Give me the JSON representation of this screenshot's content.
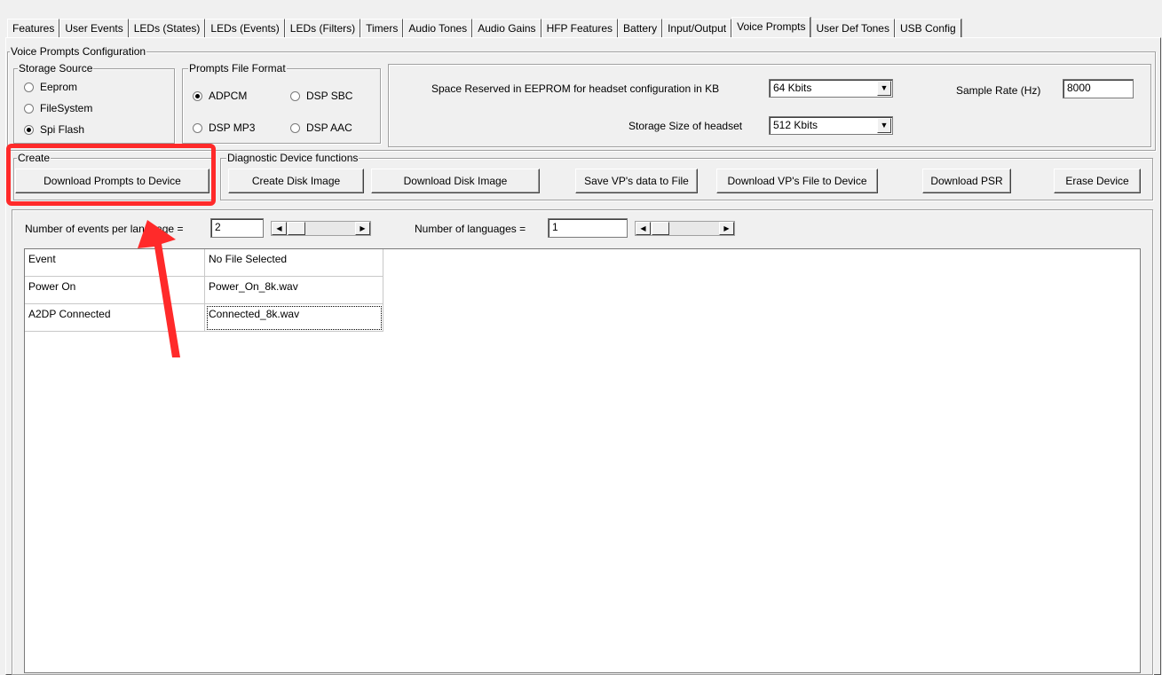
{
  "tabs": [
    {
      "label": "Features",
      "active": false
    },
    {
      "label": "User Events",
      "active": false
    },
    {
      "label": "LEDs (States)",
      "active": false
    },
    {
      "label": "LEDs (Events)",
      "active": false
    },
    {
      "label": "LEDs (Filters)",
      "active": false
    },
    {
      "label": "Timers",
      "active": false
    },
    {
      "label": "Audio Tones",
      "active": false
    },
    {
      "label": "Audio Gains",
      "active": false
    },
    {
      "label": "HFP Features",
      "active": false
    },
    {
      "label": "Battery",
      "active": false
    },
    {
      "label": "Input/Output",
      "active": false
    },
    {
      "label": "Voice Prompts",
      "active": true
    },
    {
      "label": "User Def Tones",
      "active": false
    },
    {
      "label": "USB Config",
      "active": false
    }
  ],
  "config": {
    "title": "Voice Prompts Configuration",
    "storage": {
      "legend": "Storage Source",
      "options": [
        "Eeprom",
        "FileSystem",
        "Spi Flash"
      ],
      "selected": "Spi Flash"
    },
    "format": {
      "legend": "Prompts File Format",
      "options": [
        "ADPCM",
        "DSP SBC",
        "DSP MP3",
        "DSP AAC"
      ],
      "selected": "ADPCM"
    },
    "space_label": "Space Reserved in EEPROM for  headset configuration in KB",
    "space_value": "64 Kbits",
    "size_label": "Storage Size of headset",
    "size_value": "512 Kbits",
    "rate_label": "Sample Rate (Hz)",
    "rate_value": "8000"
  },
  "create": {
    "legend": "Create",
    "download_prompts": "Download Prompts to Device"
  },
  "diagnostic": {
    "legend": "Diagnostic Device functions",
    "create_image": "Create Disk Image",
    "download_image": "Download Disk Image",
    "save_vp": "Save VP's data to File",
    "download_vp": "Download VP's File to Device",
    "download_psr": "Download PSR",
    "erase": "Erase Device"
  },
  "counts": {
    "events_label": "Number of events per language =",
    "events_value": "2",
    "languages_label": "Number of languages =",
    "languages_value": "1"
  },
  "grid": {
    "rows": [
      [
        "Event",
        "No File Selected"
      ],
      [
        "Power On",
        "Power_On_8k.wav"
      ],
      [
        "A2DP Connected",
        "Connected_8k.wav"
      ]
    ]
  },
  "colors": {
    "highlight": "#ff2a2a"
  }
}
